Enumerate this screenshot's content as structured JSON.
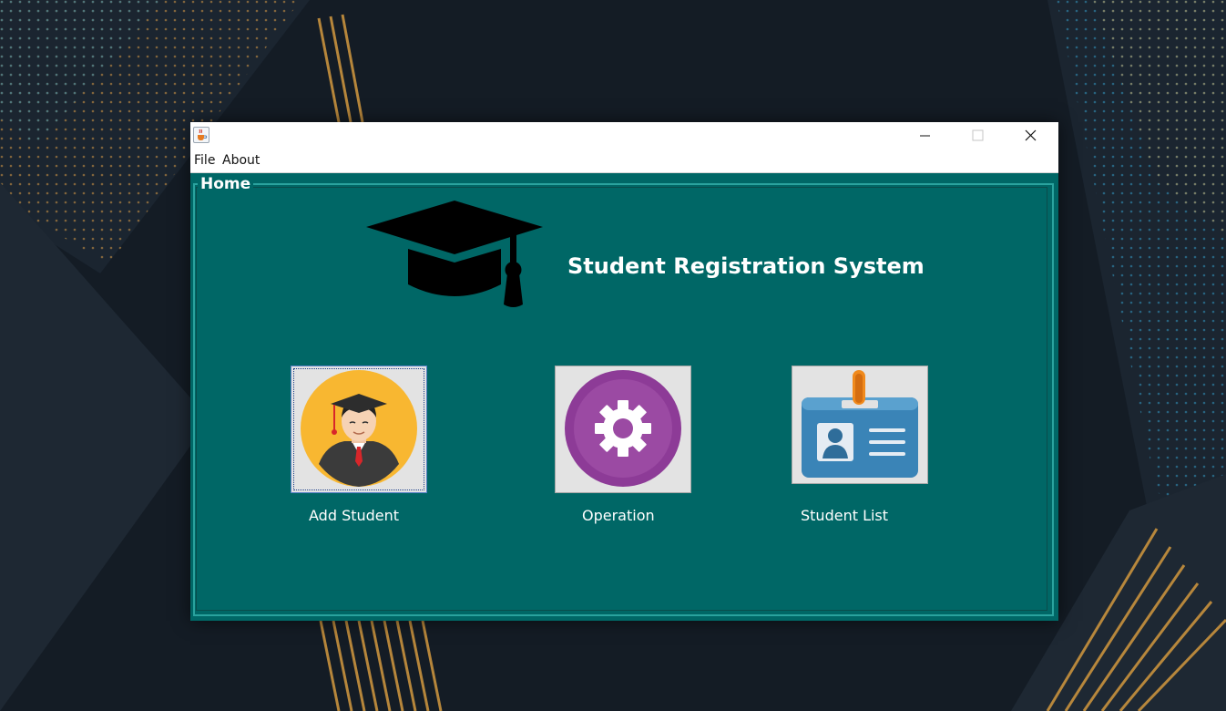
{
  "window": {
    "app_icon": "java-cup-icon",
    "controls": {
      "minimize_icon": "minimize-icon",
      "maximize_icon": "maximize-icon",
      "close_icon": "close-icon"
    }
  },
  "menubar": {
    "items": [
      {
        "label": "File"
      },
      {
        "label": "About"
      }
    ]
  },
  "home": {
    "panel_title": "Home",
    "header_icon": "graduation-cap-icon",
    "system_title": "Student Registration System",
    "tiles": [
      {
        "label": "Add Student",
        "icon": "student-graduate-icon"
      },
      {
        "label": "Operation",
        "icon": "gear-icon"
      },
      {
        "label": "Student List",
        "icon": "id-card-icon"
      }
    ]
  },
  "colors": {
    "content_bg": "#006766",
    "frame_border": "#2aa39e",
    "title_text": "#ffffff"
  }
}
